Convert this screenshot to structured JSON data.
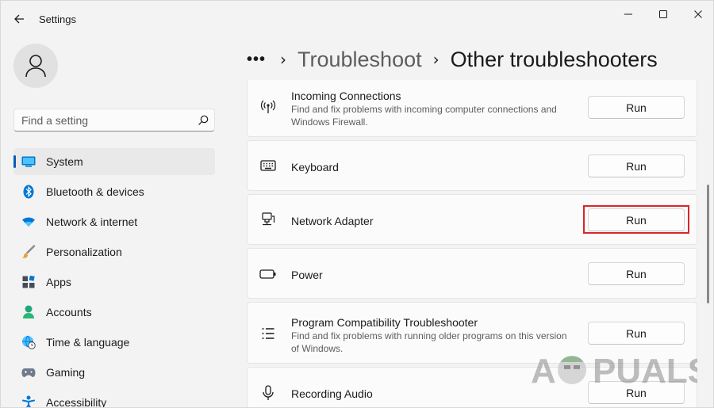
{
  "window": {
    "title": "Settings",
    "controls": [
      "minimize",
      "maximize",
      "close"
    ]
  },
  "sidebar": {
    "avatar_icon": "person-icon",
    "search": {
      "placeholder": "Find a setting",
      "value": ""
    },
    "items": [
      {
        "label": "System",
        "icon": "monitor-icon",
        "active": true
      },
      {
        "label": "Bluetooth & devices",
        "icon": "bluetooth-icon"
      },
      {
        "label": "Network & internet",
        "icon": "wifi-icon"
      },
      {
        "label": "Personalization",
        "icon": "brush-icon"
      },
      {
        "label": "Apps",
        "icon": "apps-icon"
      },
      {
        "label": "Accounts",
        "icon": "accounts-icon"
      },
      {
        "label": "Time & language",
        "icon": "globe-clock-icon"
      },
      {
        "label": "Gaming",
        "icon": "gamepad-icon"
      },
      {
        "label": "Accessibility",
        "icon": "accessibility-icon"
      }
    ]
  },
  "header": {
    "more": "•••",
    "separator": "›",
    "parent": "Troubleshoot",
    "current": "Other troubleshooters"
  },
  "troubleshooters": [
    {
      "title": "Incoming Connections",
      "description": "Find and fix problems with incoming computer connections and Windows Firewall.",
      "button": "Run",
      "icon": "antenna-icon"
    },
    {
      "title": "Keyboard",
      "description": "",
      "button": "Run",
      "icon": "keyboard-icon"
    },
    {
      "title": "Network Adapter",
      "description": "",
      "button": "Run",
      "icon": "network-adapter-icon",
      "highlighted": true
    },
    {
      "title": "Power",
      "description": "",
      "button": "Run",
      "icon": "battery-icon"
    },
    {
      "title": "Program Compatibility Troubleshooter",
      "description": "Find and fix problems with running older programs on this version of Windows.",
      "button": "Run",
      "icon": "list-icon"
    },
    {
      "title": "Recording Audio",
      "description": "",
      "button": "Run",
      "icon": "microphone-icon"
    }
  ],
  "watermark": {
    "text": "APPUALS"
  },
  "colors": {
    "accent": "#005fb8",
    "highlight": "#d9262a",
    "background": "#f3f3f3",
    "card": "#fbfbfb"
  }
}
